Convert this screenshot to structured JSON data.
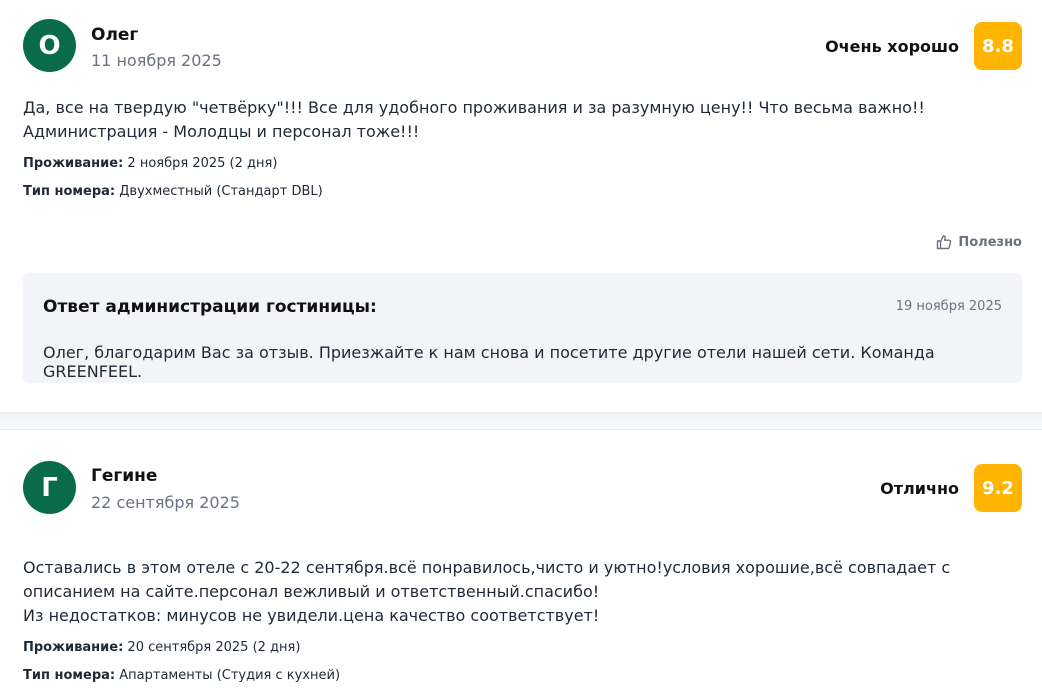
{
  "reviews": [
    {
      "initial": "О",
      "name": "Олег",
      "date": "11 ноября 2025",
      "rating_label": "Очень хорошо",
      "rating_value": "8.8",
      "text": "Да, все на твердую \"четвёрку\"!!! Все для удобного проживания и за разумную цену!! Что весьма важно!! Администрация - Молодцы и персонал тоже!!!",
      "stay_label": "Проживание:",
      "stay_value": "2 ноября 2025 (2 дня)",
      "room_label": "Тип номера:",
      "room_value": "Двухместный (Стандарт DBL)",
      "useful_label": "Полезно",
      "reply": {
        "title": "Ответ администрации гостиницы:",
        "date": "19 ноября 2025",
        "text": "Олег, благодарим Вас за отзыв. Приезжайте к нам снова и посетите другие отели нашей сети. Команда GREENFEEL."
      }
    },
    {
      "initial": "Г",
      "name": "Гегине",
      "date": "22 сентября 2025",
      "rating_label": "Отлично",
      "rating_value": "9.2",
      "text": "Оставались в этом отеле с 20-22 сентября.всё понравилось,чисто и уютно!условия хорошие,всё совпадает с описанием на сайте.персонал вежливый и ответственный.спасибо!\nИз недостатков: минусов не увидели.цена качество соответствует!",
      "stay_label": "Проживание:",
      "stay_value": "20 сентября 2025 (2 дня)",
      "room_label": "Тип номера:",
      "room_value": "Апартаменты (Студия с кухней)"
    }
  ],
  "colors": {
    "avatar": "#0a6b4b",
    "score": "#ffb400",
    "reply_bg": "#f2f4f7"
  },
  "icons": {
    "useful": "thumbs-up-icon"
  }
}
